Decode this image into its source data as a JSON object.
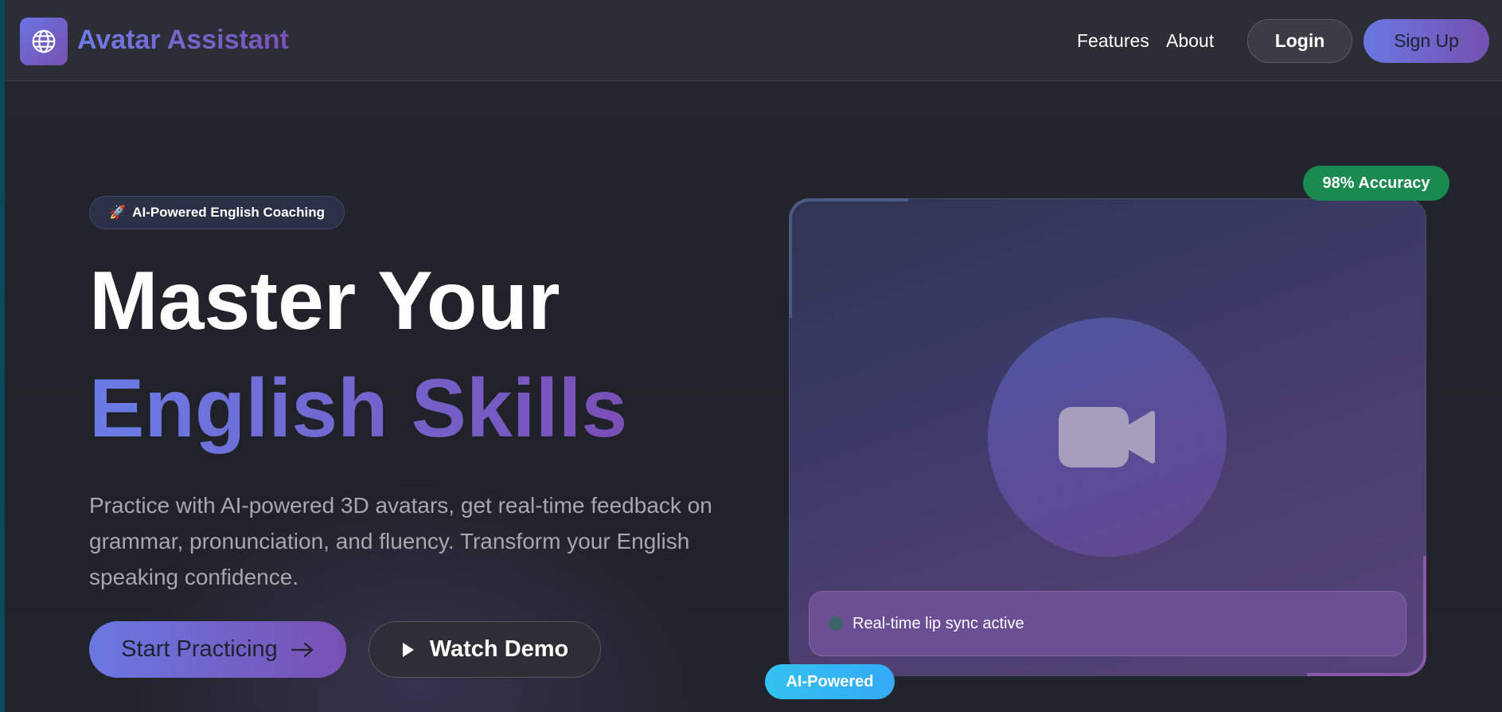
{
  "header": {
    "brand": "Avatar Assistant",
    "logo_icon": "globe-icon",
    "nav": [
      {
        "label": "Features"
      },
      {
        "label": "About"
      }
    ],
    "login_label": "Login",
    "signup_label": "Sign Up"
  },
  "hero": {
    "pill_icon": "🚀",
    "pill_label": "AI-Powered English Coaching",
    "title_line1": "Master Your",
    "title_line2": "English Skills",
    "description": "Practice with AI-powered 3D avatars, get real-time feedback on grammar, pronunciation, and fluency. Transform your English speaking confidence.",
    "start_label": "Start Practicing",
    "start_icon": "arrow-right-icon",
    "demo_label": "Watch Demo",
    "demo_icon": "play-icon"
  },
  "card": {
    "center_icon": "video-camera-icon",
    "status_text": "Real-time lip sync active",
    "accuracy_badge": "98% Accuracy",
    "ai_badge": "AI-Powered"
  },
  "colors": {
    "accent_start": "#6a78e2",
    "accent_end": "#7550b0",
    "accuracy_green": "#1b8a50",
    "ai_cyan": "#33c2f0"
  }
}
